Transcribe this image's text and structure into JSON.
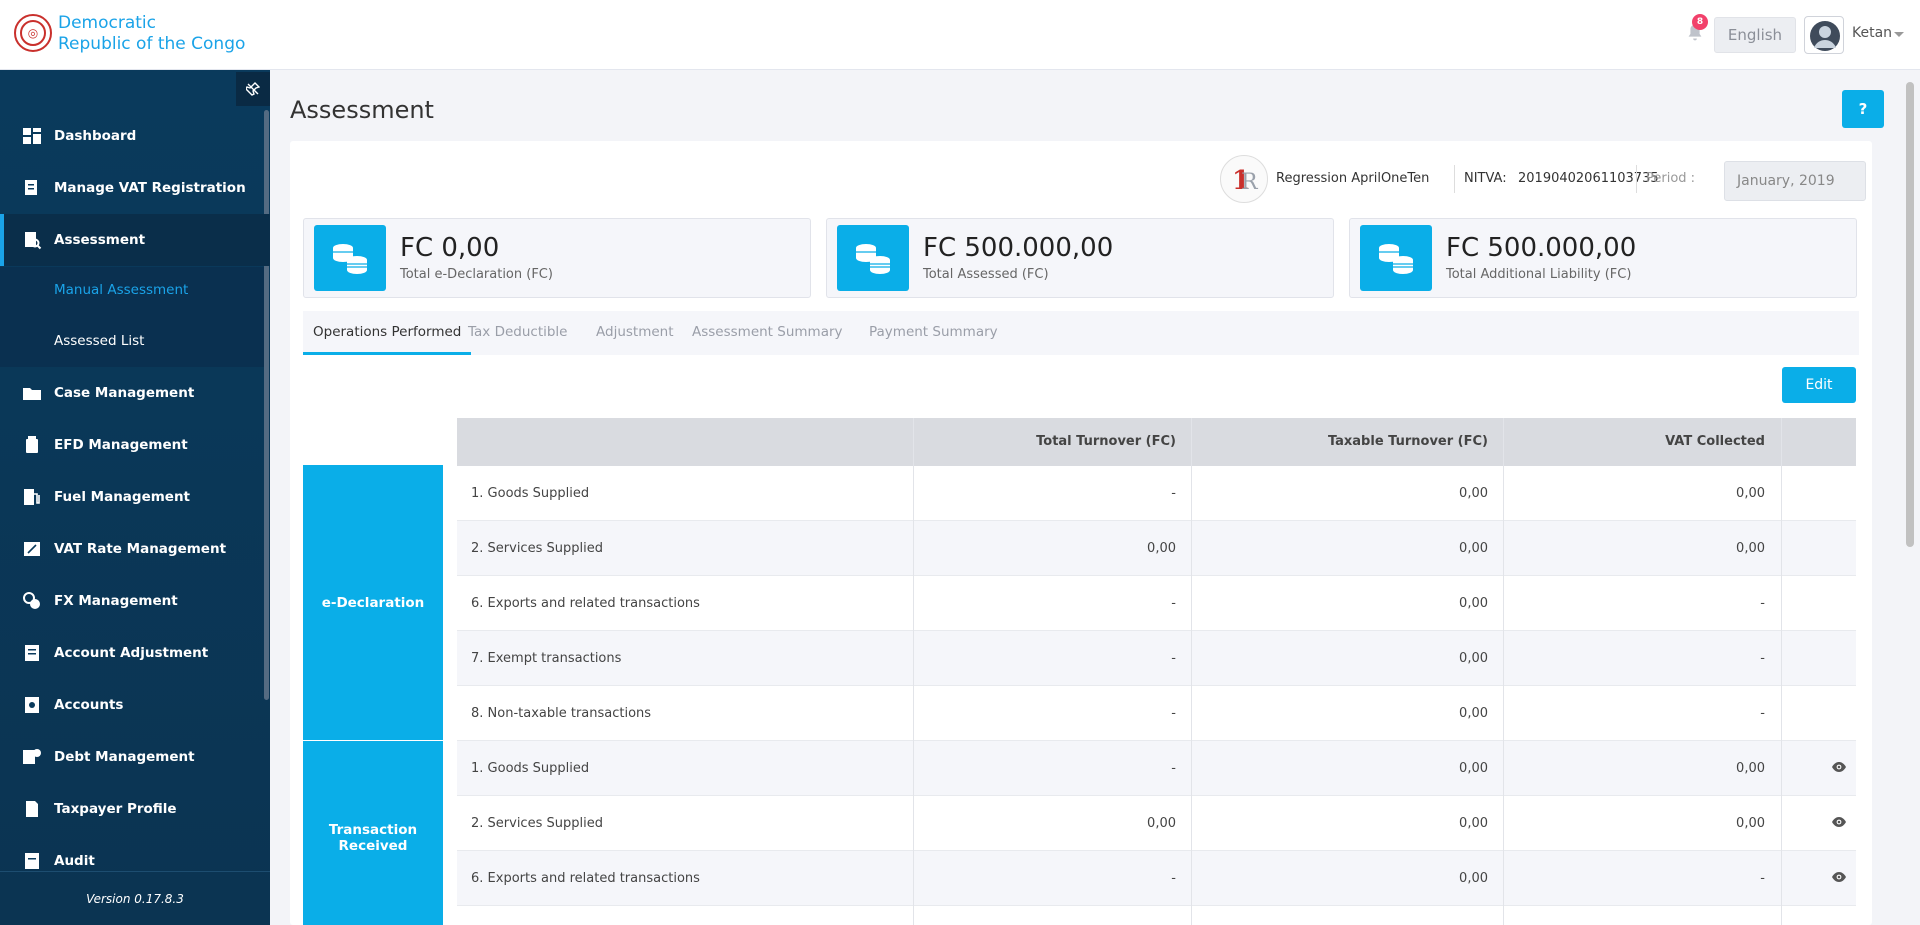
{
  "header": {
    "brand_line1": "Democratic",
    "brand_line2": "Republic of the Congo",
    "notifications_count": "8",
    "language": "English",
    "username": "Ketan"
  },
  "sidebar": {
    "items": [
      {
        "label": "Dashboard",
        "icon": "dashboard-icon"
      },
      {
        "label": "Manage VAT Registration",
        "icon": "registration-icon"
      },
      {
        "label": "Assessment",
        "icon": "assessment-icon"
      },
      {
        "label": "Case Management",
        "icon": "folder-icon"
      },
      {
        "label": "EFD Management",
        "icon": "device-icon"
      },
      {
        "label": "Fuel Management",
        "icon": "fuel-icon"
      },
      {
        "label": "VAT Rate Management",
        "icon": "rate-icon"
      },
      {
        "label": "FX Management",
        "icon": "fx-icon"
      },
      {
        "label": "Account Adjustment",
        "icon": "adjust-icon"
      },
      {
        "label": "Accounts",
        "icon": "accounts-icon"
      },
      {
        "label": "Debt Management",
        "icon": "debt-icon"
      },
      {
        "label": "Taxpayer Profile",
        "icon": "profile-icon"
      },
      {
        "label": "Audit",
        "icon": "audit-icon"
      }
    ],
    "submenu": [
      "Manual Assessment",
      "Assessed List"
    ],
    "version": "Version 0.17.8.3"
  },
  "page": {
    "title": "Assessment",
    "help": "?"
  },
  "taxpayer": {
    "name": "Regression AprilOneTen",
    "nitva_label": "NITVA:",
    "nitva": "20190402061103735",
    "period_label": "Period :",
    "period": "January, 2019"
  },
  "cards": [
    {
      "amount": "FC 0,00",
      "label": "Total e-Declaration (FC)"
    },
    {
      "amount": "FC 500.000,00",
      "label": "Total Assessed (FC)"
    },
    {
      "amount": "FC 500.000,00",
      "label": "Total Additional Liability (FC)"
    }
  ],
  "tabs": [
    "Operations Performed",
    "Tax Deductible",
    "Adjustment",
    "Assessment Summary",
    "Payment Summary"
  ],
  "edit_label": "Edit",
  "table": {
    "headers": [
      "Total Turnover (FC)",
      "Taxable Turnover (FC)",
      "VAT Collected"
    ],
    "groups": [
      "e-Declaration",
      "Transaction Received"
    ],
    "rows": [
      {
        "label": "1. Goods Supplied",
        "total": "-",
        "taxable": "0,00",
        "vat": "0,00"
      },
      {
        "label": "2. Services Supplied",
        "total": "0,00",
        "taxable": "0,00",
        "vat": "0,00"
      },
      {
        "label": "6. Exports and related transactions",
        "total": "-",
        "taxable": "0,00",
        "vat": "-"
      },
      {
        "label": "7. Exempt transactions",
        "total": "-",
        "taxable": "0,00",
        "vat": "-"
      },
      {
        "label": "8. Non-taxable transactions",
        "total": "-",
        "taxable": "0,00",
        "vat": "-"
      },
      {
        "label": "1. Goods Supplied",
        "total": "-",
        "taxable": "0,00",
        "vat": "0,00"
      },
      {
        "label": "2. Services Supplied",
        "total": "0,00",
        "taxable": "0,00",
        "vat": "0,00"
      },
      {
        "label": "6. Exports and related transactions",
        "total": "-",
        "taxable": "0,00",
        "vat": "-"
      }
    ]
  }
}
